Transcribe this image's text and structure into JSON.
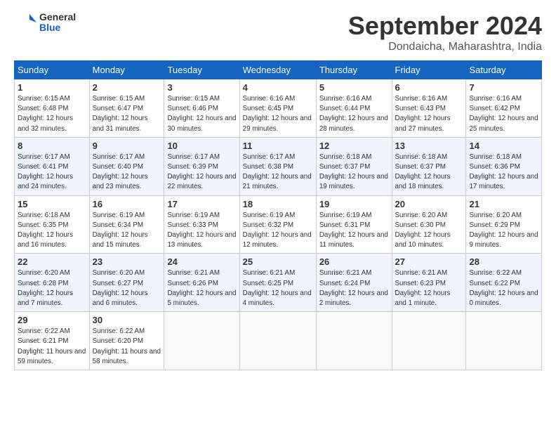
{
  "header": {
    "logo_line1": "General",
    "logo_line2": "Blue",
    "month": "September 2024",
    "location": "Dondaicha, Maharashtra, India"
  },
  "days_of_week": [
    "Sunday",
    "Monday",
    "Tuesday",
    "Wednesday",
    "Thursday",
    "Friday",
    "Saturday"
  ],
  "weeks": [
    [
      {
        "day": "1",
        "rise": "6:15 AM",
        "set": "6:48 PM",
        "daylight": "12 hours and 32 minutes."
      },
      {
        "day": "2",
        "rise": "6:15 AM",
        "set": "6:47 PM",
        "daylight": "12 hours and 31 minutes."
      },
      {
        "day": "3",
        "rise": "6:15 AM",
        "set": "6:46 PM",
        "daylight": "12 hours and 30 minutes."
      },
      {
        "day": "4",
        "rise": "6:16 AM",
        "set": "6:45 PM",
        "daylight": "12 hours and 29 minutes."
      },
      {
        "day": "5",
        "rise": "6:16 AM",
        "set": "6:44 PM",
        "daylight": "12 hours and 28 minutes."
      },
      {
        "day": "6",
        "rise": "6:16 AM",
        "set": "6:43 PM",
        "daylight": "12 hours and 27 minutes."
      },
      {
        "day": "7",
        "rise": "6:16 AM",
        "set": "6:42 PM",
        "daylight": "12 hours and 25 minutes."
      }
    ],
    [
      {
        "day": "8",
        "rise": "6:17 AM",
        "set": "6:41 PM",
        "daylight": "12 hours and 24 minutes."
      },
      {
        "day": "9",
        "rise": "6:17 AM",
        "set": "6:40 PM",
        "daylight": "12 hours and 23 minutes."
      },
      {
        "day": "10",
        "rise": "6:17 AM",
        "set": "6:39 PM",
        "daylight": "12 hours and 22 minutes."
      },
      {
        "day": "11",
        "rise": "6:17 AM",
        "set": "6:38 PM",
        "daylight": "12 hours and 21 minutes."
      },
      {
        "day": "12",
        "rise": "6:18 AM",
        "set": "6:37 PM",
        "daylight": "12 hours and 19 minutes."
      },
      {
        "day": "13",
        "rise": "6:18 AM",
        "set": "6:37 PM",
        "daylight": "12 hours and 18 minutes."
      },
      {
        "day": "14",
        "rise": "6:18 AM",
        "set": "6:36 PM",
        "daylight": "12 hours and 17 minutes."
      }
    ],
    [
      {
        "day": "15",
        "rise": "6:18 AM",
        "set": "6:35 PM",
        "daylight": "12 hours and 16 minutes."
      },
      {
        "day": "16",
        "rise": "6:19 AM",
        "set": "6:34 PM",
        "daylight": "12 hours and 15 minutes."
      },
      {
        "day": "17",
        "rise": "6:19 AM",
        "set": "6:33 PM",
        "daylight": "12 hours and 13 minutes."
      },
      {
        "day": "18",
        "rise": "6:19 AM",
        "set": "6:32 PM",
        "daylight": "12 hours and 12 minutes."
      },
      {
        "day": "19",
        "rise": "6:19 AM",
        "set": "6:31 PM",
        "daylight": "12 hours and 11 minutes."
      },
      {
        "day": "20",
        "rise": "6:20 AM",
        "set": "6:30 PM",
        "daylight": "12 hours and 10 minutes."
      },
      {
        "day": "21",
        "rise": "6:20 AM",
        "set": "6:29 PM",
        "daylight": "12 hours and 9 minutes."
      }
    ],
    [
      {
        "day": "22",
        "rise": "6:20 AM",
        "set": "6:28 PM",
        "daylight": "12 hours and 7 minutes."
      },
      {
        "day": "23",
        "rise": "6:20 AM",
        "set": "6:27 PM",
        "daylight": "12 hours and 6 minutes."
      },
      {
        "day": "24",
        "rise": "6:21 AM",
        "set": "6:26 PM",
        "daylight": "12 hours and 5 minutes."
      },
      {
        "day": "25",
        "rise": "6:21 AM",
        "set": "6:25 PM",
        "daylight": "12 hours and 4 minutes."
      },
      {
        "day": "26",
        "rise": "6:21 AM",
        "set": "6:24 PM",
        "daylight": "12 hours and 2 minutes."
      },
      {
        "day": "27",
        "rise": "6:21 AM",
        "set": "6:23 PM",
        "daylight": "12 hours and 1 minute."
      },
      {
        "day": "28",
        "rise": "6:22 AM",
        "set": "6:22 PM",
        "daylight": "12 hours and 0 minutes."
      }
    ],
    [
      {
        "day": "29",
        "rise": "6:22 AM",
        "set": "6:21 PM",
        "daylight": "11 hours and 59 minutes."
      },
      {
        "day": "30",
        "rise": "6:22 AM",
        "set": "6:20 PM",
        "daylight": "11 hours and 58 minutes."
      },
      null,
      null,
      null,
      null,
      null
    ]
  ]
}
